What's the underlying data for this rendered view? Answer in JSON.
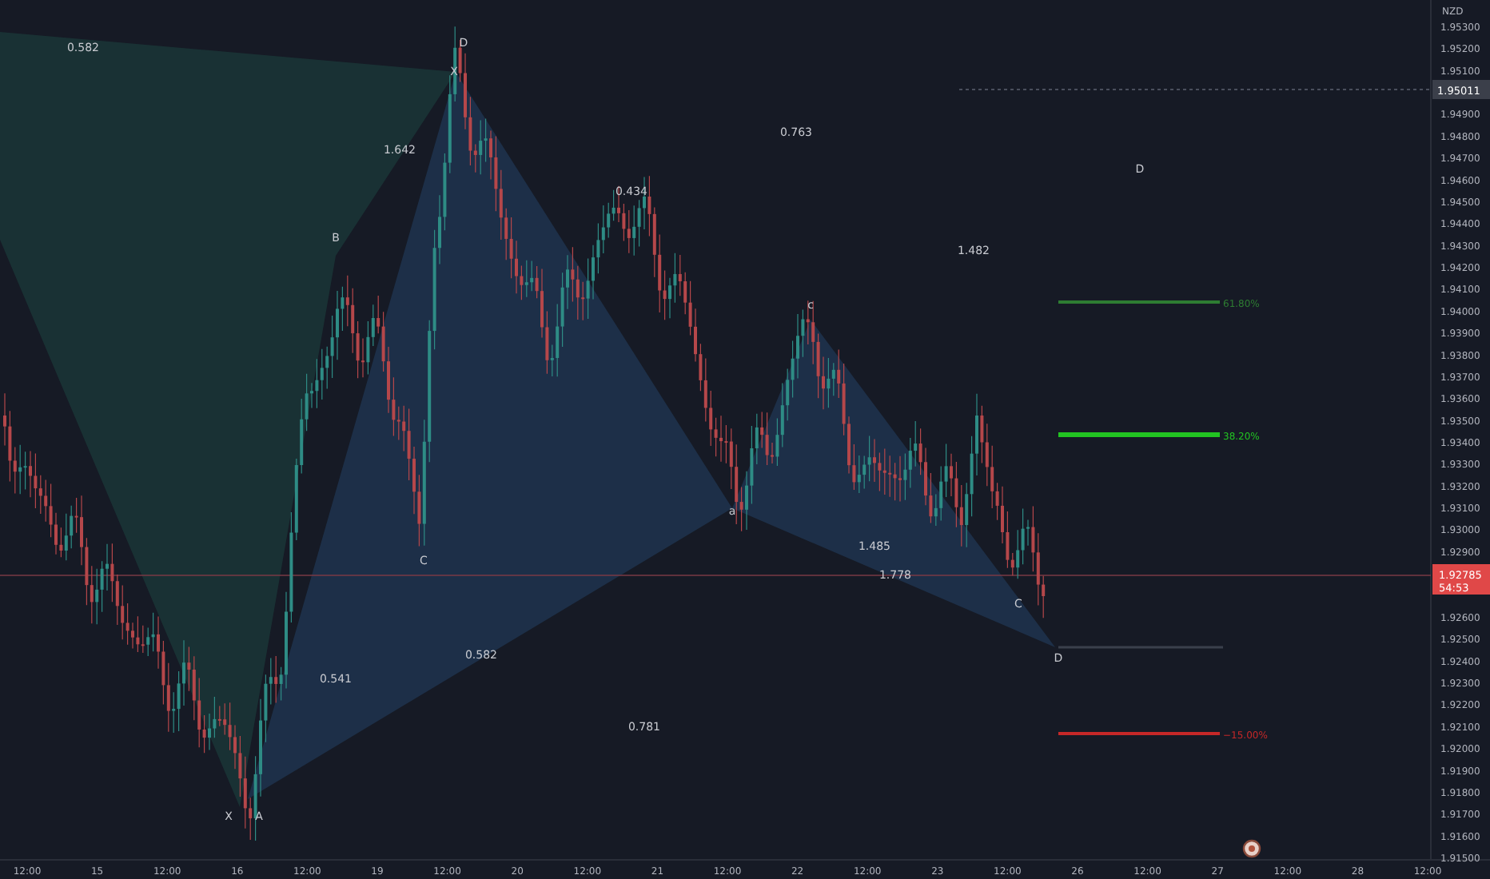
{
  "price_axis": {
    "currency": "NZD",
    "ticks": [
      "1.95300",
      "1.95200",
      "1.95100",
      "1.94900",
      "1.94800",
      "1.94700",
      "1.94600",
      "1.94500",
      "1.94400",
      "1.94300",
      "1.94200",
      "1.94100",
      "1.94000",
      "1.93900",
      "1.93800",
      "1.93700",
      "1.93600",
      "1.93500",
      "1.93400",
      "1.93300",
      "1.93200",
      "1.93100",
      "1.93000",
      "1.92900",
      "1.92600",
      "1.92500",
      "1.92400",
      "1.92300",
      "1.92200",
      "1.92100",
      "1.92000",
      "1.91900",
      "1.91800",
      "1.91700",
      "1.91600",
      "1.91500"
    ],
    "last_price": "1.95011",
    "current_price": {
      "value": "1.92785",
      "countdown": "54:53"
    }
  },
  "time_axis": [
    "12:00",
    "15",
    "12:00",
    "16",
    "12:00",
    "19",
    "12:00",
    "20",
    "12:00",
    "21",
    "12:00",
    "22",
    "12:00",
    "23",
    "12:00",
    "26",
    "12:00",
    "27",
    "12:00",
    "28",
    "12:00"
  ],
  "pattern_labels": [
    {
      "text": "0.582"
    },
    {
      "text": "1.642"
    },
    {
      "text": "D"
    },
    {
      "text": "X"
    },
    {
      "text": "B"
    },
    {
      "text": "C"
    },
    {
      "text": "X"
    },
    {
      "text": "A"
    },
    {
      "text": "0.541"
    },
    {
      "text": "0.582"
    },
    {
      "text": "0.781"
    },
    {
      "text": "0.763"
    },
    {
      "text": "0.434"
    },
    {
      "text": "a"
    },
    {
      "text": "c"
    },
    {
      "text": "1.485"
    },
    {
      "text": "1.778"
    },
    {
      "text": "1.482"
    },
    {
      "text": "D"
    },
    {
      "text": "C"
    },
    {
      "text": "D"
    }
  ],
  "fib_levels": [
    {
      "label": "61.80%",
      "color": "#2e7d32"
    },
    {
      "label": "38.20%",
      "color": "#22c322"
    },
    {
      "label": "−15.00%",
      "color": "#c62828"
    }
  ]
}
